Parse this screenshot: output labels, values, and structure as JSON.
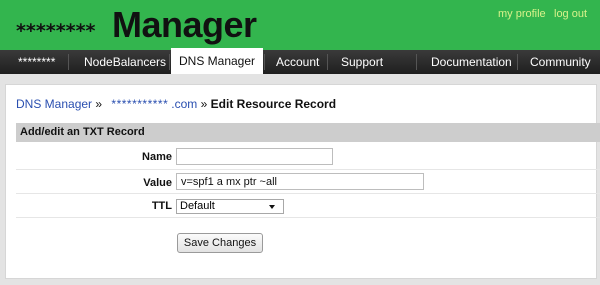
{
  "header": {
    "logo_mask": "********",
    "logo_word": "Manager",
    "links": {
      "my_profile": "my profile",
      "log_out": "log out"
    }
  },
  "nav": {
    "items": [
      "********",
      "NodeBalancers",
      "DNS Manager",
      "Account",
      "Support",
      "Documentation",
      "Community"
    ],
    "active": "DNS Manager"
  },
  "breadcrumb": {
    "dns_manager": "DNS Manager",
    "sep1": "»",
    "domain_mask": "***********",
    "domain_suffix": ".com",
    "sep2": "»",
    "current": "Edit Resource Record"
  },
  "form": {
    "section_title": "Add/edit an TXT Record",
    "name": {
      "label": "Name",
      "value": ""
    },
    "value": {
      "label": "Value",
      "value": "v=spf1 a mx ptr ~all"
    },
    "ttl": {
      "label": "TTL",
      "selected": "Default"
    },
    "submit_label": "Save Changes"
  },
  "colors": {
    "header_green": "#33b54e",
    "nav_dark": "#2a2a2a",
    "link_blue": "#2a4fb0",
    "top_link": "#d8f28a"
  }
}
